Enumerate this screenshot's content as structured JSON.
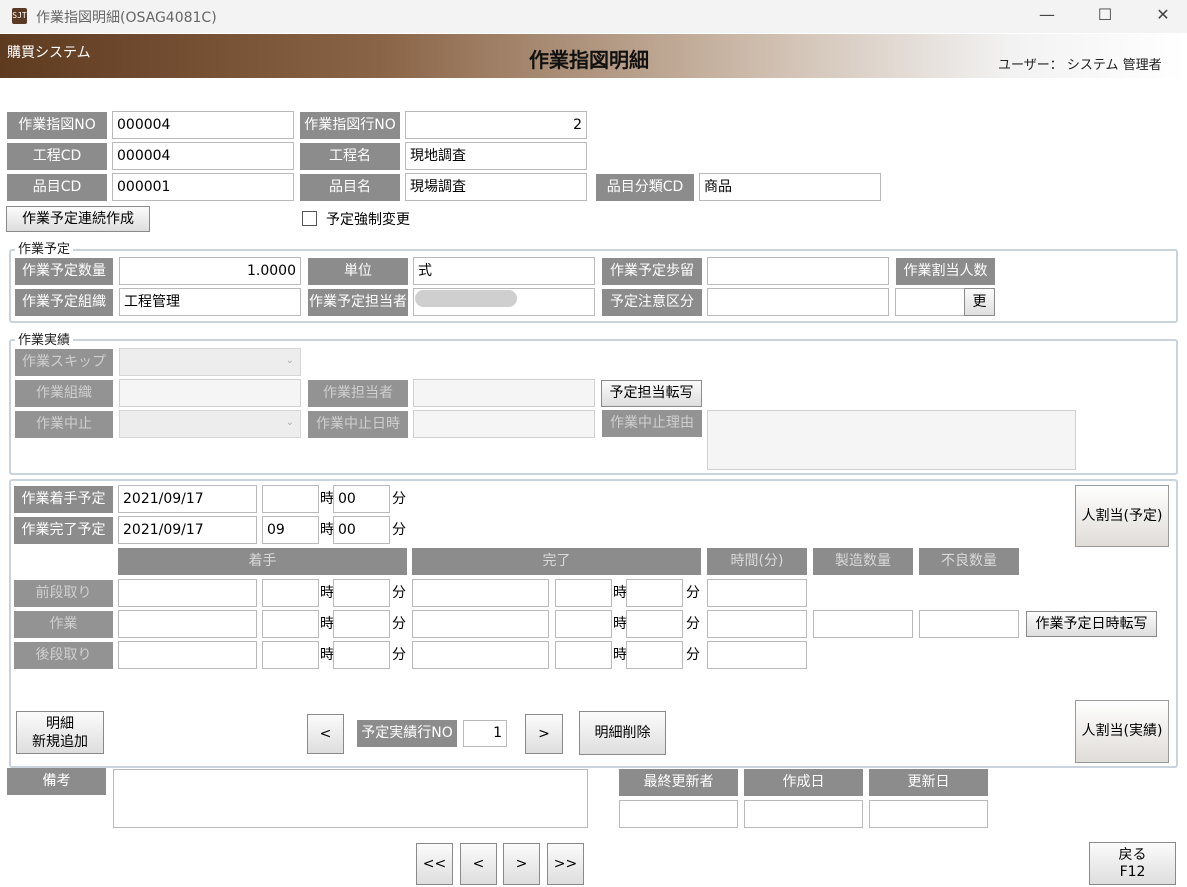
{
  "window": {
    "title": "作業指図明細(OSAG4081C)",
    "icon_text": "SJT",
    "min": "—",
    "max": "☐",
    "close": "✕"
  },
  "header": {
    "system": "購買システム",
    "page_title": "作業指図明細",
    "user": "ユーザー： システム 管理者"
  },
  "top": {
    "order_no_label": "作業指図NO",
    "order_no": "000004",
    "order_line_label": "作業指図行NO",
    "order_line": "2",
    "process_cd_label": "工程CD",
    "process_cd": "000004",
    "process_name_label": "工程名",
    "process_name": "現地調査",
    "item_cd_label": "品目CD",
    "item_cd": "000001",
    "item_name_label": "品目名",
    "item_name": "現場調査",
    "item_class_label": "品目分類CD",
    "item_class": "商品",
    "continuous_btn": "作業予定連続作成",
    "force_change_label": "予定強制変更"
  },
  "plan": {
    "title": "作業予定",
    "qty_label": "作業予定数量",
    "qty": "1.0000",
    "unit_label": "単位",
    "unit": "式",
    "yield_label": "作業予定歩留",
    "yield": "",
    "assign_count_label": "作業割当人数",
    "org_label": "作業予定組織",
    "org": "工程管理",
    "person_label": "作業予定担当者",
    "caution_label": "予定注意区分",
    "update_btn": "更"
  },
  "actual": {
    "title": "作業実績",
    "skip_label": "作業スキップ",
    "org_label": "作業組織",
    "person_label": "作業担当者",
    "copy_person_btn": "予定担当転写",
    "stop_label": "作業中止",
    "stop_datetime_label": "作業中止日時",
    "stop_reason_label": "作業中止理由"
  },
  "schedule": {
    "start_label": "作業着手予定",
    "start_date": "2021/09/17",
    "start_hour": "",
    "start_min": "00",
    "end_label": "作業完了予定",
    "end_date": "2021/09/17",
    "end_hour": "09",
    "end_min": "00",
    "hour_unit": "時",
    "min_unit": "分",
    "assign_plan_btn": "人割当(予定)",
    "assign_actual_btn": "人割当(実績)",
    "col_start": "着手",
    "col_end": "完了",
    "col_time": "時間(分)",
    "col_produced": "製造数量",
    "col_defect": "不良数量",
    "rows": [
      {
        "label": "前段取り"
      },
      {
        "label": "作業"
      },
      {
        "label": "後段取り"
      }
    ],
    "copy_datetime_btn": "作業予定日時転写",
    "new_detail_btn_l1": "明細",
    "new_detail_btn_l2": "新規追加",
    "prev_btn": "<",
    "next_btn": ">",
    "line_no_label": "予定実績行NO",
    "line_no": "1",
    "delete_btn": "明細削除"
  },
  "footer": {
    "note_label": "備考",
    "last_updater_label": "最終更新者",
    "created_label": "作成日",
    "updated_label": "更新日",
    "nav_first": "<<",
    "nav_prev": "<",
    "nav_next": ">",
    "nav_last": ">>",
    "back_btn_l1": "戻る",
    "back_btn_l2": "F12"
  },
  "colors": {
    "label_bg": "#8c8c8c",
    "header_dark": "#5e3a1f",
    "group_border": "#c9d3de"
  }
}
